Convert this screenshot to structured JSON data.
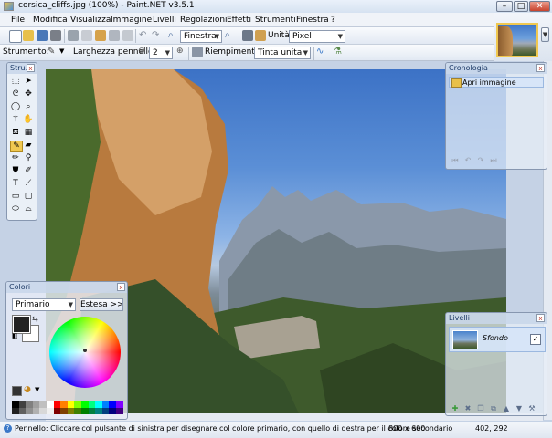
{
  "window": {
    "title": "corsica_cliffs.jpg (100%) - Paint.NET v3.5.1",
    "minimize": "–",
    "maximize": "□",
    "close": "✕"
  },
  "menu": [
    "File",
    "Modifica",
    "Visualizza",
    "Immagine",
    "Livelli",
    "Regolazioni",
    "Effetti",
    "Strumenti",
    "Finestra",
    "?"
  ],
  "toolbar1": {
    "zoom_value": "Finestra",
    "units_label": "Unità:",
    "units_value": "Pixel"
  },
  "toolbar2": {
    "tool_label": "Strumento:",
    "brush_width_label": "Larghezza pennello:",
    "brush_width_value": "2",
    "fill_label": "Riempimento:",
    "fill_value": "Tinta unita"
  },
  "tools_panel": {
    "title": "Stru..."
  },
  "history_panel": {
    "title": "Cronologia",
    "items": [
      "Apri immagine"
    ]
  },
  "layers_panel": {
    "title": "Livelli",
    "layers": [
      {
        "name": "Sfondo",
        "visible_mark": "✓"
      }
    ]
  },
  "colors_panel": {
    "title": "Colori",
    "mode_value": "Primario",
    "expand_button": "Estesa >>",
    "primary_color": "#222222",
    "secondary_color": "#ffffff"
  },
  "status": {
    "message": "Pennello: Cliccare col pulsante di sinistra per disegnare col colore primario, con quello di destra per il colore secondario",
    "image_size": "800 x 600",
    "cursor_pos": "402, 292"
  },
  "colors": {
    "accent": "#3a78c8",
    "highlight": "#f0c850",
    "sky": "#5b8fd6"
  }
}
